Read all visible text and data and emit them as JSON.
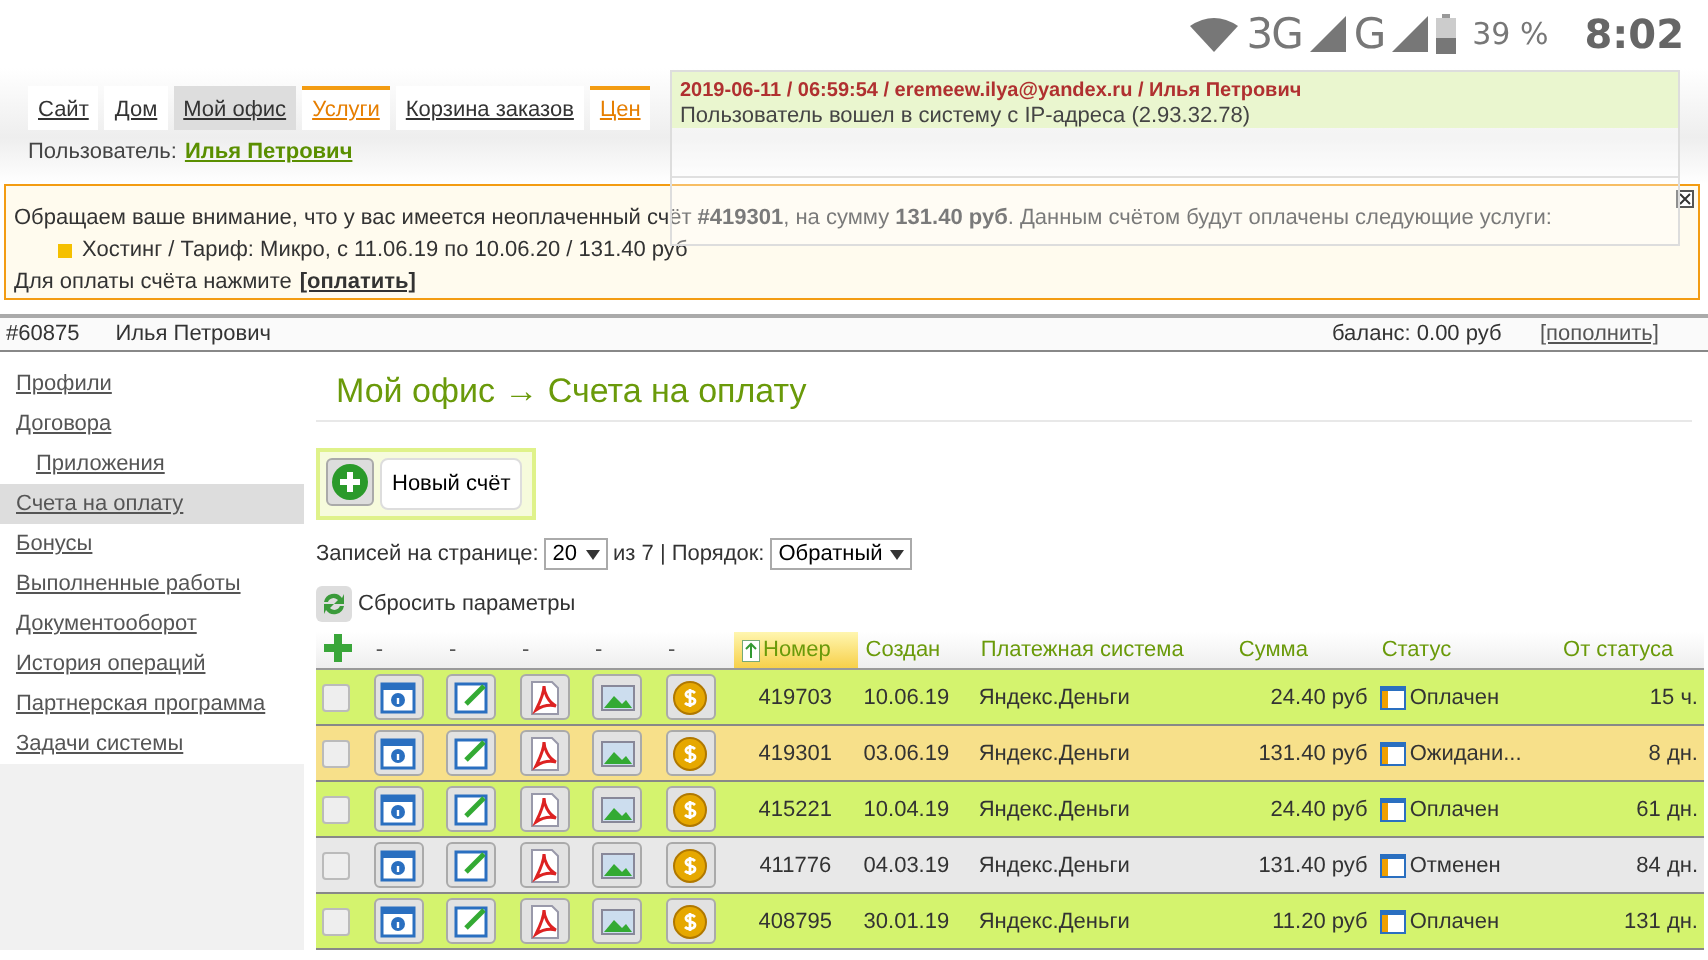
{
  "status_bar": {
    "network_1": "3G",
    "network_2": "G",
    "battery": "39 %",
    "time": "8:02"
  },
  "nav": {
    "tabs": [
      {
        "label": "Сайт",
        "selected": false,
        "highlighted": false
      },
      {
        "label": "Дом",
        "selected": false,
        "highlighted": false
      },
      {
        "label": "Мой офис",
        "selected": true,
        "highlighted": false
      },
      {
        "label": "Услуги",
        "selected": false,
        "highlighted": true
      },
      {
        "label": "Корзина заказов",
        "selected": false,
        "highlighted": false
      },
      {
        "label": "Цен",
        "selected": false,
        "highlighted": true
      }
    ]
  },
  "user_line": {
    "label": "Пользователь:",
    "name": "Илья Петрович"
  },
  "notice": {
    "text": "Обращаем ваше внимание, что у вас имеется неоплаченный счёт **#419301**, на сумму **131.40 руб**. Данным счётом будут оплачены следующие услуги:",
    "item": "Хостинг / Тариф: Микро, с 11.06.19 по 10.06.20 / 131.40 руб",
    "pay_text": "Для оплаты счёта нажмите",
    "pay_link": "[оплатить]"
  },
  "account_bar": {
    "id": "#60875",
    "name": "Илья Петрович",
    "balance": "баланс: 0.00 руб",
    "topup": "[пополнить]"
  },
  "sidebar": {
    "items": [
      {
        "label": "Профили",
        "selected": false
      },
      {
        "label": "Договора",
        "selected": false,
        "children": [
          {
            "label": "Приложения",
            "selected": false
          }
        ]
      },
      {
        "label": "Счета на оплату",
        "selected": true
      },
      {
        "label": "Бонусы",
        "selected": false
      },
      {
        "label": "Выполненные работы",
        "selected": false
      },
      {
        "label": "Документооборот",
        "selected": false
      },
      {
        "label": "История операций",
        "selected": false
      },
      {
        "label": "Партнерская программа",
        "selected": false
      },
      {
        "label": "Задачи системы",
        "selected": false
      }
    ]
  },
  "title": "Мой офис → Счета на оплату",
  "new_button": "Новый счёт",
  "pagination": {
    "per_page_label": "Записей на странице:",
    "per_page": "20",
    "pages": "из 7 | Порядок:",
    "order": "Обратный"
  },
  "reset": "Сбросить параметры",
  "table": {
    "action_columns": [
      "-",
      "-",
      "-",
      "-",
      "-"
    ],
    "columns": [
      {
        "label": "Номер",
        "sorted": true
      },
      {
        "label": "Создан",
        "sorted": false
      },
      {
        "label": "Платежная система",
        "sorted": false
      },
      {
        "label": "Сумма",
        "sorted": false
      },
      {
        "label": "Статус",
        "sorted": false
      },
      {
        "label": "От статуса",
        "sorted": false
      }
    ],
    "rows": [
      {
        "checked": false,
        "kind": "paid",
        "number": "419703",
        "created": "10.06.19",
        "system": "Яндекс.Деньги",
        "amount": "24.40 руб",
        "status": "Оплачен",
        "since": "15 ч."
      },
      {
        "checked": false,
        "kind": "pending",
        "number": "419301",
        "created": "03.06.19",
        "system": "Яндекс.Деньги",
        "amount": "131.40 руб",
        "status": "Ожидани...",
        "since": "8 дн."
      },
      {
        "checked": false,
        "kind": "paid",
        "number": "415221",
        "created": "10.04.19",
        "system": "Яндекс.Деньги",
        "amount": "24.40 руб",
        "status": "Оплачен",
        "since": "61 дн."
      },
      {
        "checked": false,
        "kind": "cancelled",
        "number": "411776",
        "created": "04.03.19",
        "system": "Яндекс.Деньги",
        "amount": "131.40 руб",
        "status": "Отменен",
        "since": "84 дн."
      },
      {
        "checked": false,
        "kind": "paid",
        "number": "408795",
        "created": "30.01.19",
        "system": "Яндекс.Деньги",
        "amount": "11.20 руб",
        "status": "Оплачен",
        "since": "131 дн."
      }
    ]
  },
  "popup": {
    "header": "2019-06-11 / 06:59:54 / eremeew.ilya@yandex.ru / Илья Петрович",
    "message": "Пользователь вошел в систему с IP-адреса (2.93.32.78)"
  }
}
